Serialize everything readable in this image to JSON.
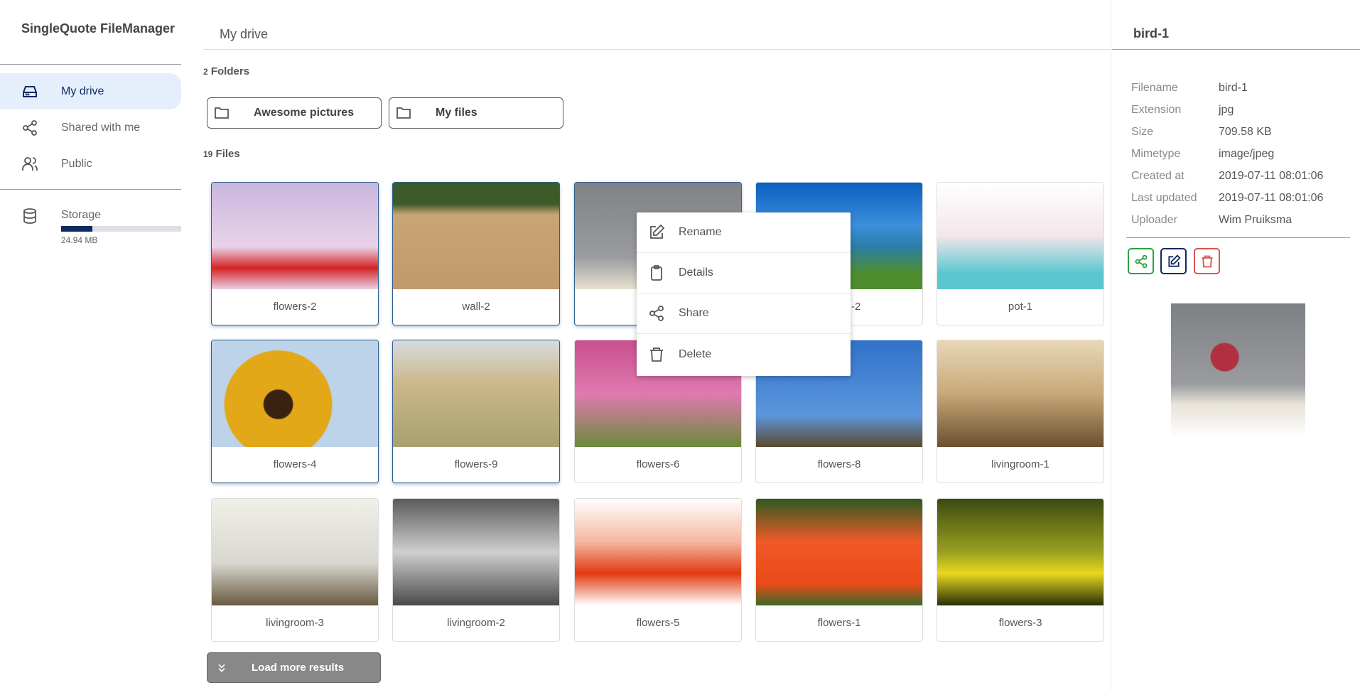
{
  "app": {
    "title": "SingleQuote FileManager"
  },
  "sidebar": {
    "items": [
      {
        "label": "My drive",
        "icon": "drive-icon",
        "active": true
      },
      {
        "label": "Shared with me",
        "icon": "share-icon"
      },
      {
        "label": "Public",
        "icon": "users-icon"
      }
    ],
    "storage": {
      "label": "Storage",
      "used": "24.94 MB",
      "fill_percent": 26
    }
  },
  "main": {
    "title": "My drive",
    "folders_count": "2",
    "folders_label": "Folders",
    "files_count": "19",
    "files_label": "Files",
    "folders": [
      {
        "name": "Awesome pictures"
      },
      {
        "name": "My files"
      }
    ],
    "files": [
      {
        "name": "flowers-2",
        "selected": true
      },
      {
        "name": "wall-2",
        "selected": true
      },
      {
        "name": "",
        "selected": true
      },
      {
        "name": "-2"
      },
      {
        "name": "pot-1"
      },
      {
        "name": "flowers-4",
        "selected": true
      },
      {
        "name": "flowers-9",
        "selected": true
      },
      {
        "name": "flowers-6"
      },
      {
        "name": "flowers-8"
      },
      {
        "name": "livingroom-1"
      },
      {
        "name": "livingroom-3"
      },
      {
        "name": "livingroom-2"
      },
      {
        "name": "flowers-5"
      },
      {
        "name": "flowers-1"
      },
      {
        "name": "flowers-3"
      }
    ],
    "load_more": "Load more results"
  },
  "context_menu": {
    "items": [
      {
        "label": "Rename",
        "icon": "edit-icon"
      },
      {
        "label": "Details",
        "icon": "clipboard-icon"
      },
      {
        "label": "Share",
        "icon": "share-icon"
      },
      {
        "label": "Delete",
        "icon": "trash-icon"
      }
    ]
  },
  "details": {
    "title": "bird-1",
    "props": [
      {
        "label": "Filename",
        "value": "bird-1"
      },
      {
        "label": "Extension",
        "value": "jpg"
      },
      {
        "label": "Size",
        "value": "709.58 KB"
      },
      {
        "label": "Mimetype",
        "value": "image/jpeg"
      },
      {
        "label": "Created at",
        "value": "2019-07-11 08:01:06"
      },
      {
        "label": "Last updated",
        "value": "2019-07-11 08:01:06"
      },
      {
        "label": "Uploader",
        "value": "Wim Pruiksma"
      }
    ],
    "colors": {
      "share": "#2ea043",
      "edit": "#0c2a5e",
      "delete": "#d9534f"
    }
  }
}
